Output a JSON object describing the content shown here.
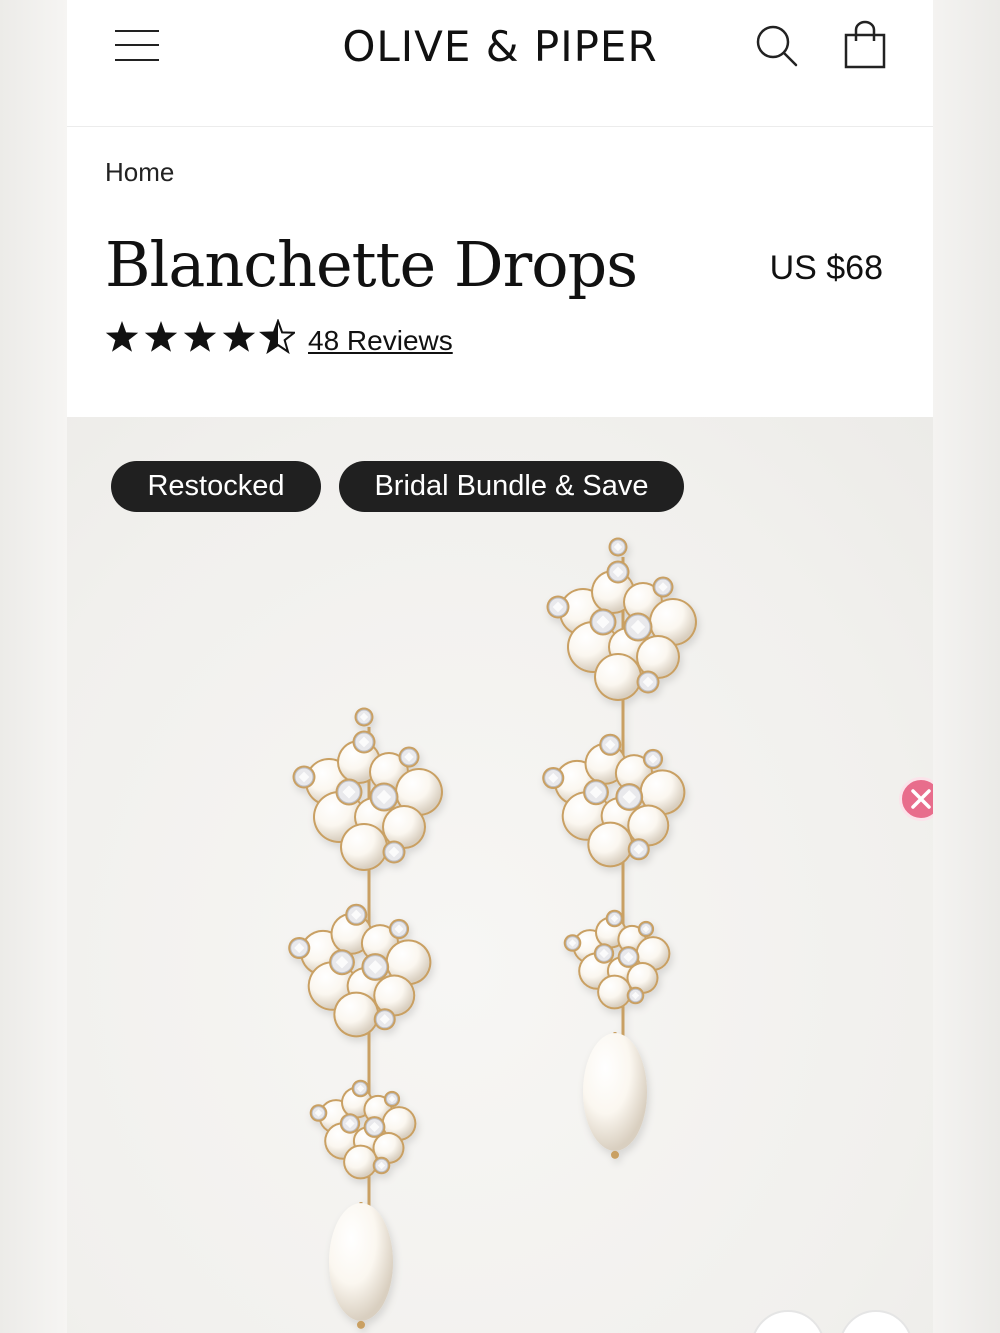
{
  "header": {
    "brand": "OLIVE & PIPER",
    "menu_icon": "hamburger-menu-icon",
    "search_icon": "search-icon",
    "cart_icon": "shopping-bag-icon"
  },
  "breadcrumb": {
    "home": "Home"
  },
  "product": {
    "title": "Blanchette Drops",
    "price": "US $68",
    "rating": 4.5,
    "rating_max": 5,
    "reviews_label": "48 Reviews"
  },
  "badges": [
    "Restocked",
    "Bridal Bundle & Save"
  ],
  "colors": {
    "badge_bg": "#202020",
    "close_button": "#e86d8c",
    "gold": "#c9a063",
    "pearl": "#fbf7f0"
  },
  "close_icon": "close-x-icon"
}
